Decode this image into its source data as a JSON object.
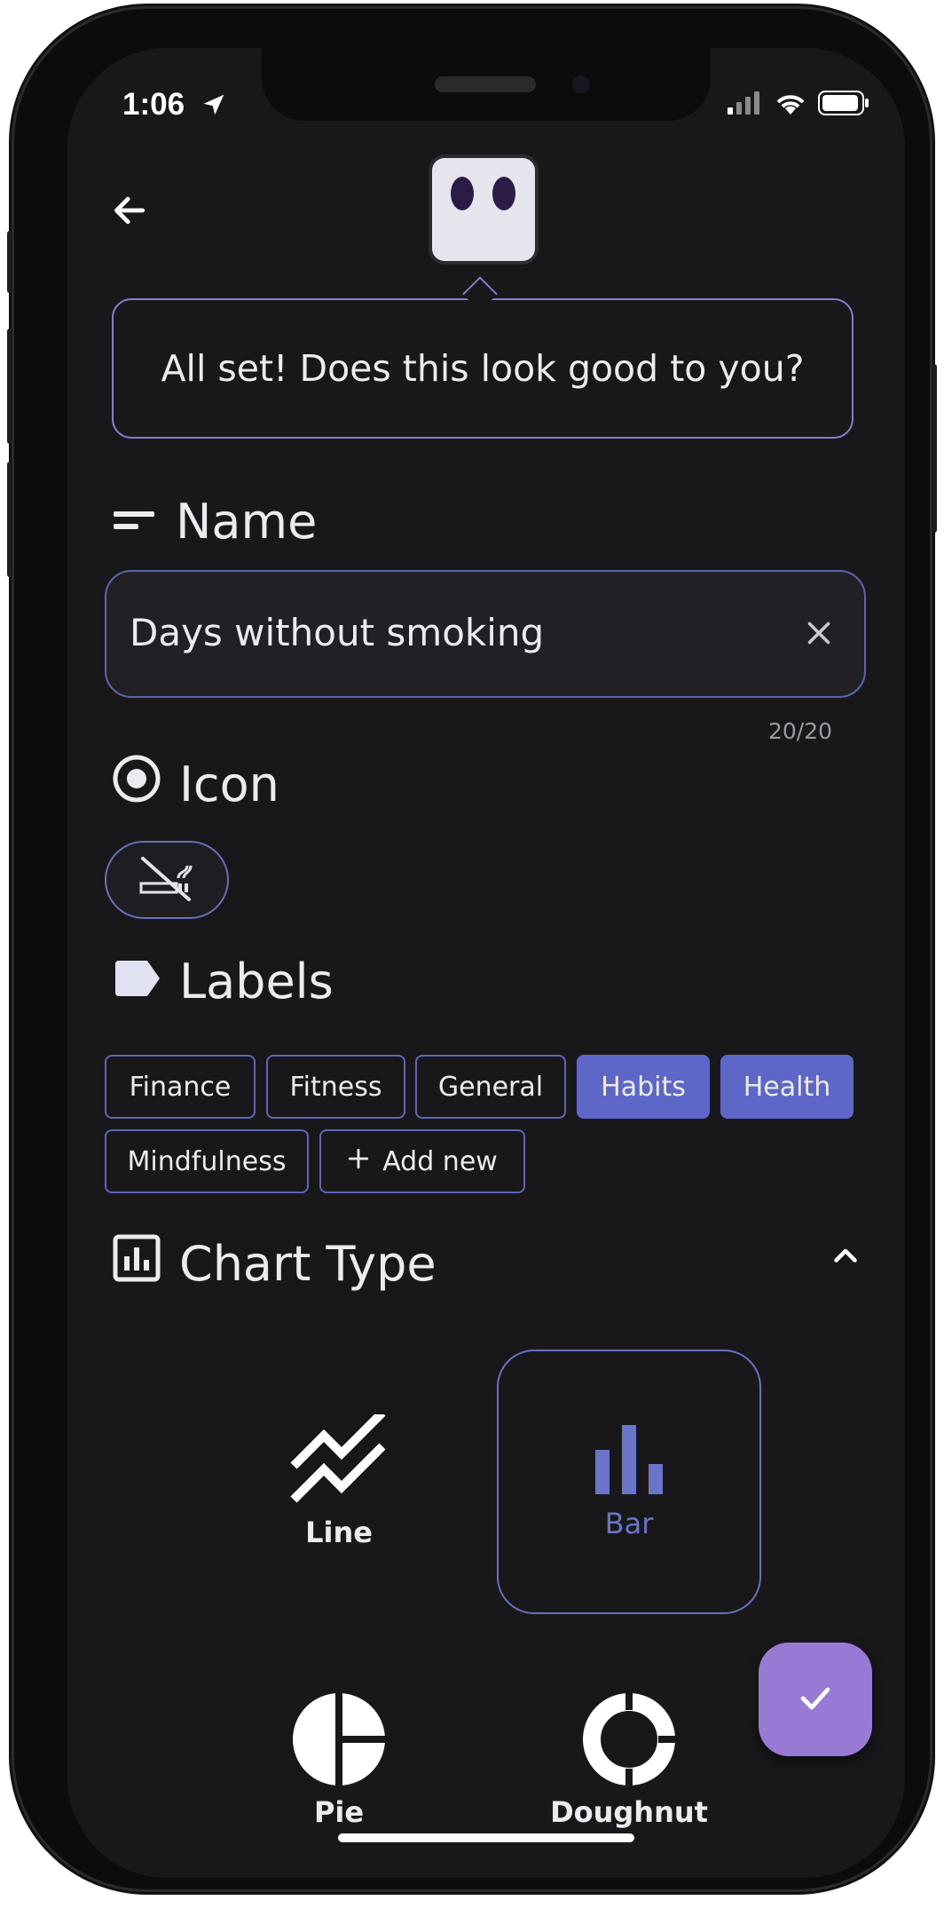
{
  "status_bar": {
    "time": "1:06"
  },
  "assistant": {
    "message": "All set! Does this look good to you?"
  },
  "name_section": {
    "title": "Name",
    "value": "Days without smoking",
    "counter": "20/20"
  },
  "icon_section": {
    "title": "Icon",
    "selected_icon": "no-smoking-icon"
  },
  "labels_section": {
    "title": "Labels",
    "chips": [
      {
        "label": "Finance",
        "selected": false
      },
      {
        "label": "Fitness",
        "selected": false
      },
      {
        "label": "General",
        "selected": false
      },
      {
        "label": "Habits",
        "selected": true
      },
      {
        "label": "Health",
        "selected": true
      },
      {
        "label": "Mindfulness",
        "selected": false
      }
    ],
    "add_new": "Add new"
  },
  "chart_type_section": {
    "title": "Chart Type",
    "options": [
      {
        "label": "Line",
        "selected": false
      },
      {
        "label": "Bar",
        "selected": true
      },
      {
        "label": "Pie",
        "selected": false
      },
      {
        "label": "Doughnut",
        "selected": false
      }
    ]
  },
  "colors": {
    "background": "#18181b",
    "accent": "#5d67c7",
    "bubble_border": "#8f78d0",
    "fab": "#9879d4",
    "text": "#ecebf0"
  }
}
